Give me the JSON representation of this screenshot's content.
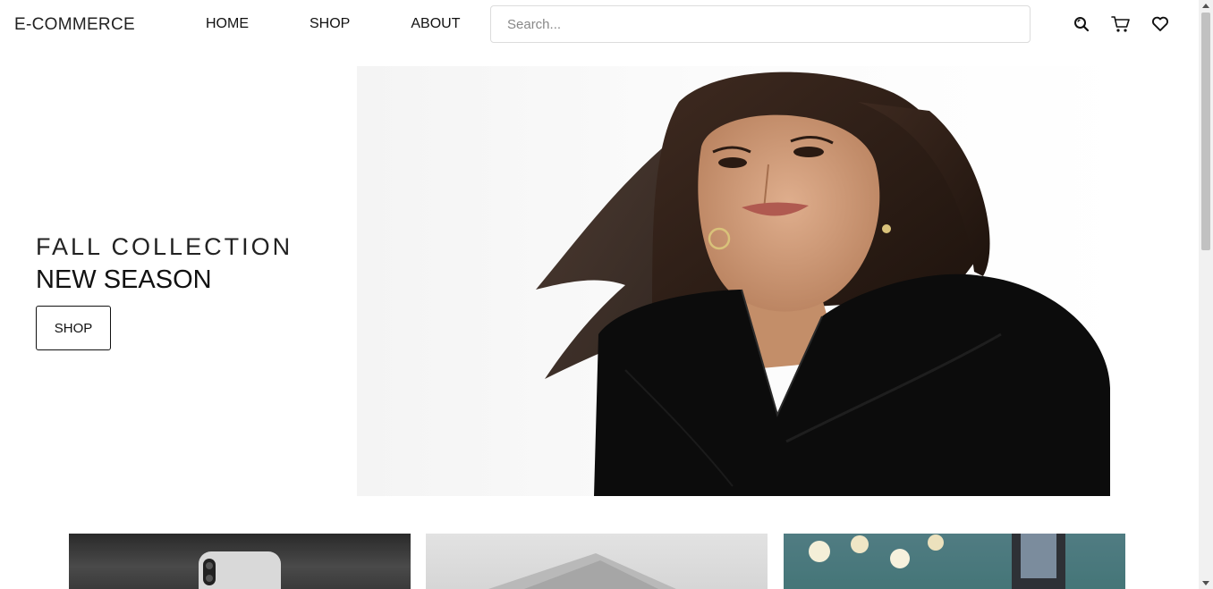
{
  "header": {
    "logo": "E-COMMERCE",
    "nav": [
      {
        "label": "HOME"
      },
      {
        "label": "SHOP"
      },
      {
        "label": "ABOUT"
      }
    ],
    "search": {
      "placeholder": "Search...",
      "value": ""
    },
    "icons": [
      "search-icon",
      "cart-icon",
      "heart-icon"
    ]
  },
  "hero": {
    "subtitle": "FALL COLLECTION",
    "title": "NEW SEASON",
    "button_label": "SHOP"
  },
  "products": [
    {
      "image": "phone-product-image"
    },
    {
      "image": "laptop-product-image"
    },
    {
      "image": "perfume-product-image"
    }
  ]
}
